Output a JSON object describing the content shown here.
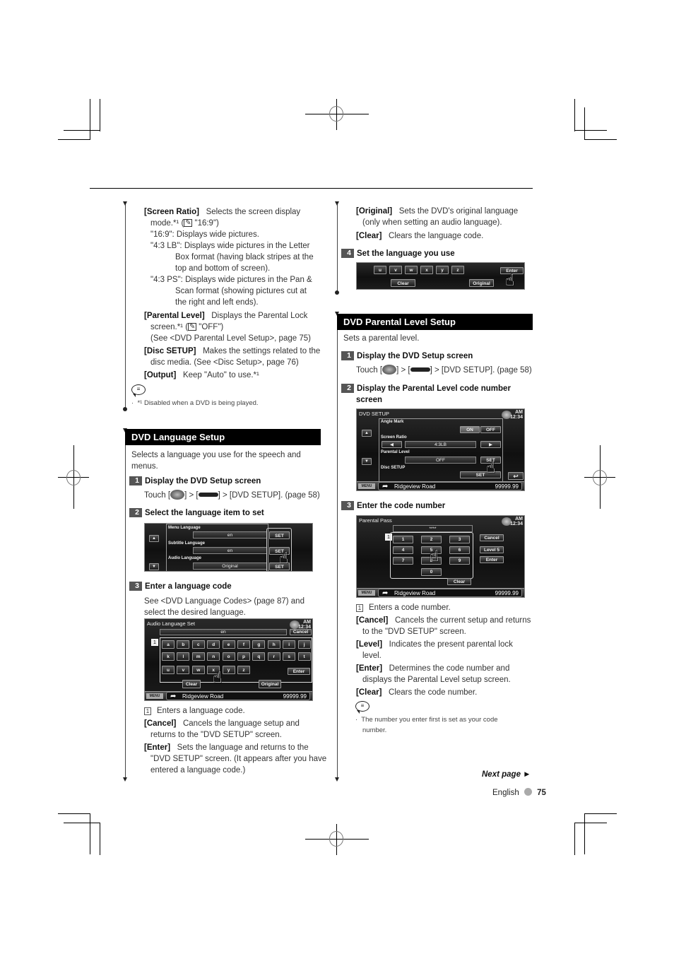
{
  "left_column": {
    "screen_ratio": {
      "label": "[Screen Ratio]",
      "desc": "Selects the screen display",
      "desc2_pre": "mode.*¹ (",
      "desc2_post": " \"16:9\")",
      "line_169": "\"16:9\": Displays wide pictures.",
      "line_43lb_key": "\"4:3 LB\":",
      "line_43lb": [
        "Displays wide pictures in the Letter",
        "Box format (having black stripes at the",
        "top and bottom of screen)."
      ],
      "line_43ps_key": "\"4:3 PS\":",
      "line_43ps": [
        "Displays wide pictures in the Pan &",
        "Scan format (showing pictures cut at",
        "the right and left ends)."
      ]
    },
    "parental_level": {
      "label": "[Parental Level]",
      "desc": "Displays the Parental Lock",
      "desc2_pre": "screen.*¹ (",
      "desc2_post": " \"OFF\")",
      "desc3": "(See <DVD Parental Level Setup>, page 75)"
    },
    "disc_setup": {
      "label": "[Disc SETUP]",
      "desc": "Makes the settings related to the",
      "desc2": "disc media. (See <Disc Setup>, page 76)"
    },
    "output": {
      "label": "[Output]",
      "desc": "Keep \"Auto\" to use.*¹"
    },
    "footnote": "*¹ Disabled when a DVD is being played.",
    "dvd_language_setup": {
      "title": "DVD Language Setup",
      "intro": [
        "Selects a language you use for the speech and",
        "menus."
      ],
      "step1": {
        "num": "1",
        "title": "Display the DVD Setup screen",
        "touch_pre": "Touch [",
        "touch_mid": "] > [",
        "touch_post": "] > [DVD SETUP]. (page 58)"
      },
      "step2": {
        "num": "2",
        "title": "Select the language item to set"
      },
      "screen_lang_items": {
        "rows": [
          {
            "label": "Menu Language",
            "value": "en",
            "button": "SET"
          },
          {
            "label": "Subtitle Language",
            "value": "en",
            "button": "SET"
          },
          {
            "label": "Audio Language",
            "value": "Original",
            "button": "SET"
          }
        ],
        "up": "▲",
        "down": "▼"
      },
      "step3": {
        "num": "3",
        "title": "Enter a language code",
        "desc": [
          "See <DVD Language Codes> (page 87) and",
          "select the desired language."
        ]
      },
      "screen_keyboard": {
        "title": "Audio Language Set",
        "clock_ampm": "AM",
        "clock_time": "12:34",
        "input_value": "en",
        "cancel": "Cancel",
        "callout": "1",
        "row1": [
          "a",
          "b",
          "c",
          "d",
          "e",
          "f",
          "g",
          "h",
          "i",
          "j"
        ],
        "row2": [
          "k",
          "l",
          "m",
          "n",
          "o",
          "p",
          "q",
          "r",
          "s",
          "t"
        ],
        "row3": [
          "u",
          "v",
          "w",
          "x",
          "y",
          "z"
        ],
        "enter": "Enter",
        "clear": "Clear",
        "original": "Original",
        "menu": "MENU",
        "road": "Ridgeview Road",
        "distance": "99999.99"
      },
      "legend": [
        {
          "num": "1",
          "text": "Enters a language code."
        },
        {
          "label": "[Cancel]",
          "text": "Cancels the language setup and",
          "text2": "returns to the \"DVD SETUP\" screen."
        },
        {
          "label": "[Enter]",
          "text": "Sets the language and returns to the",
          "text2": "\"DVD SETUP\" screen. (It appears after you have",
          "text3": "entered a language code.)"
        }
      ]
    }
  },
  "right_column": {
    "original": {
      "label": "[Original]",
      "desc": "Sets the DVD's original language",
      "desc2": "(only when setting an audio language)."
    },
    "clear": {
      "label": "[Clear]",
      "desc": "Clears the language code."
    },
    "step4": {
      "num": "4",
      "title": "Set the language you use"
    },
    "screen_partial": {
      "keys": [
        "u",
        "v",
        "w",
        "x",
        "y",
        "z"
      ],
      "clear": "Clear",
      "original": "Original",
      "enter": "Enter"
    },
    "dvd_parental_setup": {
      "title": "DVD Parental Level Setup",
      "intro": "Sets a parental level.",
      "step1": {
        "num": "1",
        "title": "Display the DVD Setup screen",
        "touch_pre": "Touch [",
        "touch_mid": "] > [",
        "touch_post": "] > [DVD SETUP]. (page 58)"
      },
      "step2": {
        "num": "2",
        "title": "Display the Parental Level code number",
        "title2": "screen"
      },
      "screen_dvd_setup": {
        "title": "DVD SETUP",
        "clock_ampm": "AM",
        "clock_time": "12:34",
        "angle_mark": "Angle Mark",
        "on": "ON",
        "off": "OFF",
        "screen_ratio": "Screen Ratio",
        "ratio_value": "4:3LB",
        "parental_level": "Parental Level",
        "parental_value": "OFF",
        "set": "SET",
        "disc_setup": "Disc SETUP",
        "menu": "MENU",
        "road": "Ridgeview Road",
        "distance": "99999.99"
      },
      "step3": {
        "num": "3",
        "title": "Enter the code number"
      },
      "screen_parental_pass": {
        "title": "Parental Pass",
        "clock_ampm": "AM",
        "clock_time": "12:34",
        "code_value": "****",
        "callout": "1",
        "digits": [
          "1",
          "2",
          "3",
          "4",
          "5",
          "6",
          "7",
          "8",
          "9",
          "0"
        ],
        "cancel": "Cancel",
        "level": "Level 5",
        "enter": "Enter",
        "clear": "Clear",
        "menu": "MENU",
        "road": "Ridgeview Road",
        "distance": "99999.99"
      },
      "legend": [
        {
          "num": "1",
          "text": "Enters a code number."
        },
        {
          "label": "[Cancel]",
          "text": "Cancels the current setup and returns",
          "text2": "to the \"DVD SETUP\" screen."
        },
        {
          "label": "[Level]",
          "text": "Indicates the present parental lock",
          "text2": "level."
        },
        {
          "label": "[Enter]",
          "text": "Determines the code number and",
          "text2": "displays the Parental Level setup screen."
        },
        {
          "label": "[Clear]",
          "text": "Clears the code number."
        }
      ],
      "note": [
        "The number you enter first is set as your code",
        "number."
      ]
    }
  },
  "footer": {
    "next_page": "Next page ►",
    "language": "English",
    "page_number": "75"
  }
}
